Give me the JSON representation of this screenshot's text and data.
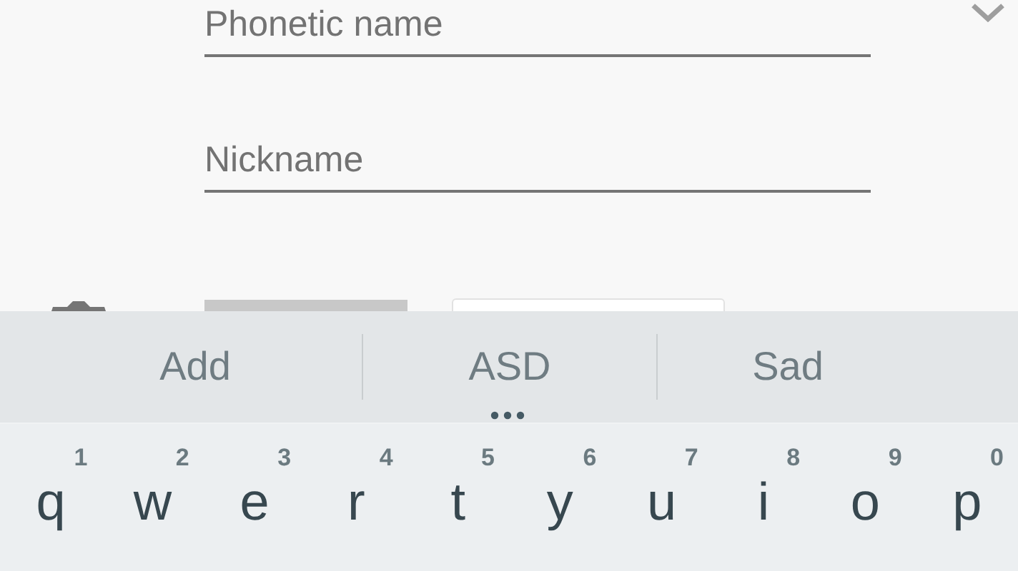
{
  "form": {
    "fields": [
      {
        "placeholder": "Phonetic name",
        "expandable": true
      },
      {
        "placeholder": "Nickname",
        "expandable": false
      }
    ]
  },
  "keyboard": {
    "suggestions": [
      "Add",
      "ASD",
      "Sad"
    ],
    "keys": [
      {
        "letter": "q",
        "hint": "1"
      },
      {
        "letter": "w",
        "hint": "2"
      },
      {
        "letter": "e",
        "hint": "3"
      },
      {
        "letter": "r",
        "hint": "4"
      },
      {
        "letter": "t",
        "hint": "5"
      },
      {
        "letter": "y",
        "hint": "6"
      },
      {
        "letter": "u",
        "hint": "7"
      },
      {
        "letter": "i",
        "hint": "8"
      },
      {
        "letter": "o",
        "hint": "9"
      },
      {
        "letter": "p",
        "hint": "0"
      }
    ]
  }
}
